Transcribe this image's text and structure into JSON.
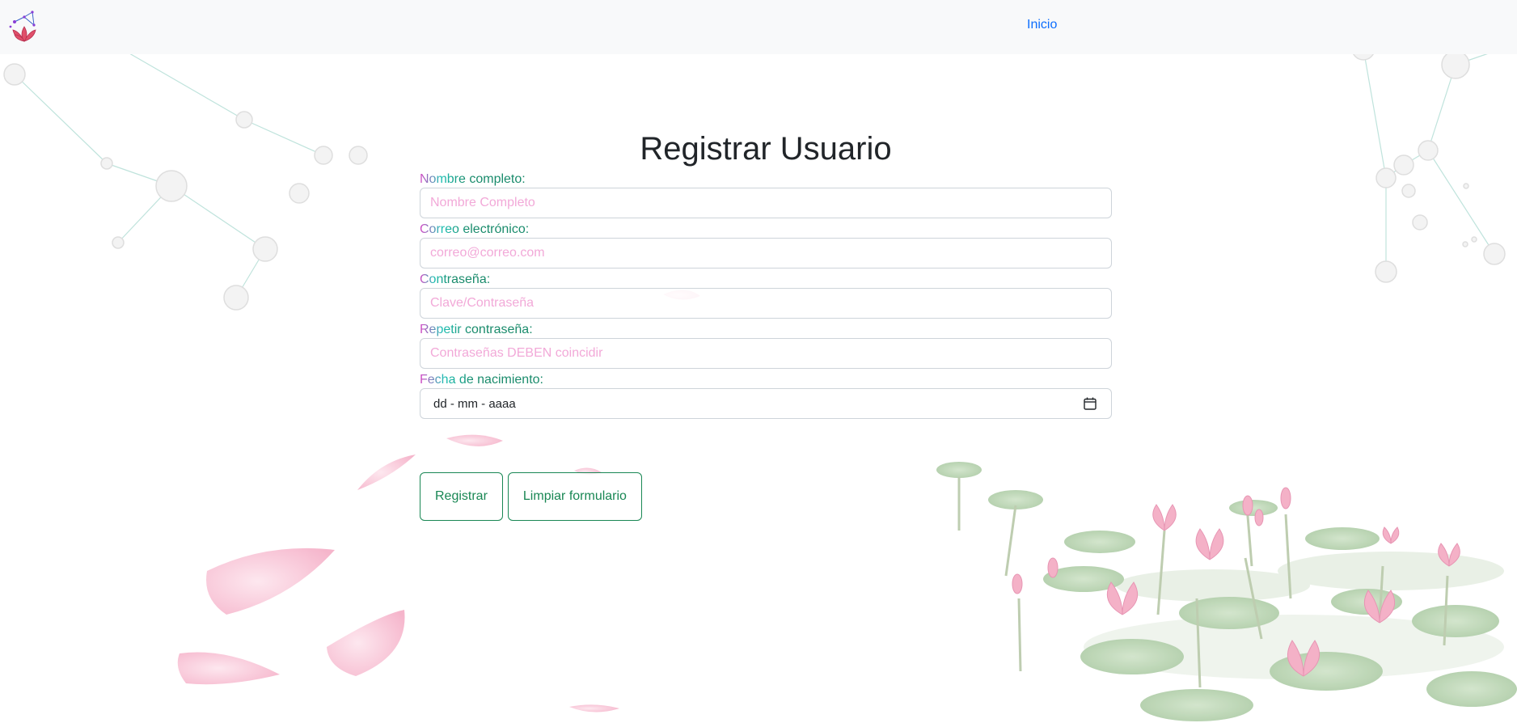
{
  "navbar": {
    "logo_icon": "lotus-constellation-logo",
    "links": [
      {
        "label": "Inicio"
      }
    ]
  },
  "form": {
    "title": "Registrar Usuario",
    "fields": [
      {
        "label": "Nombre completo:",
        "placeholder": "Nombre Completo",
        "type": "text"
      },
      {
        "label": "Correo electrónico:",
        "placeholder": "correo@correo.com",
        "type": "email"
      },
      {
        "label": "Contraseña:",
        "placeholder": "Clave/Contraseña",
        "type": "password"
      },
      {
        "label": "Repetir contraseña:",
        "placeholder": "Contraseñas DEBEN coincidir",
        "type": "password"
      }
    ],
    "date_field": {
      "label": "Fecha de nacimiento:",
      "value_display": "dd - mm - aaaa",
      "icon": "calendar-icon"
    },
    "buttons": {
      "submit_label": "Registrar",
      "reset_label": "Limpiar formulario"
    }
  },
  "theme": {
    "accent_green": "#198754",
    "link_blue": "#0d6efd",
    "placeholder_pink": "#f2a9d8",
    "label_gradient": [
      "#d946c6",
      "#1bbfb2",
      "#178a6a"
    ]
  }
}
